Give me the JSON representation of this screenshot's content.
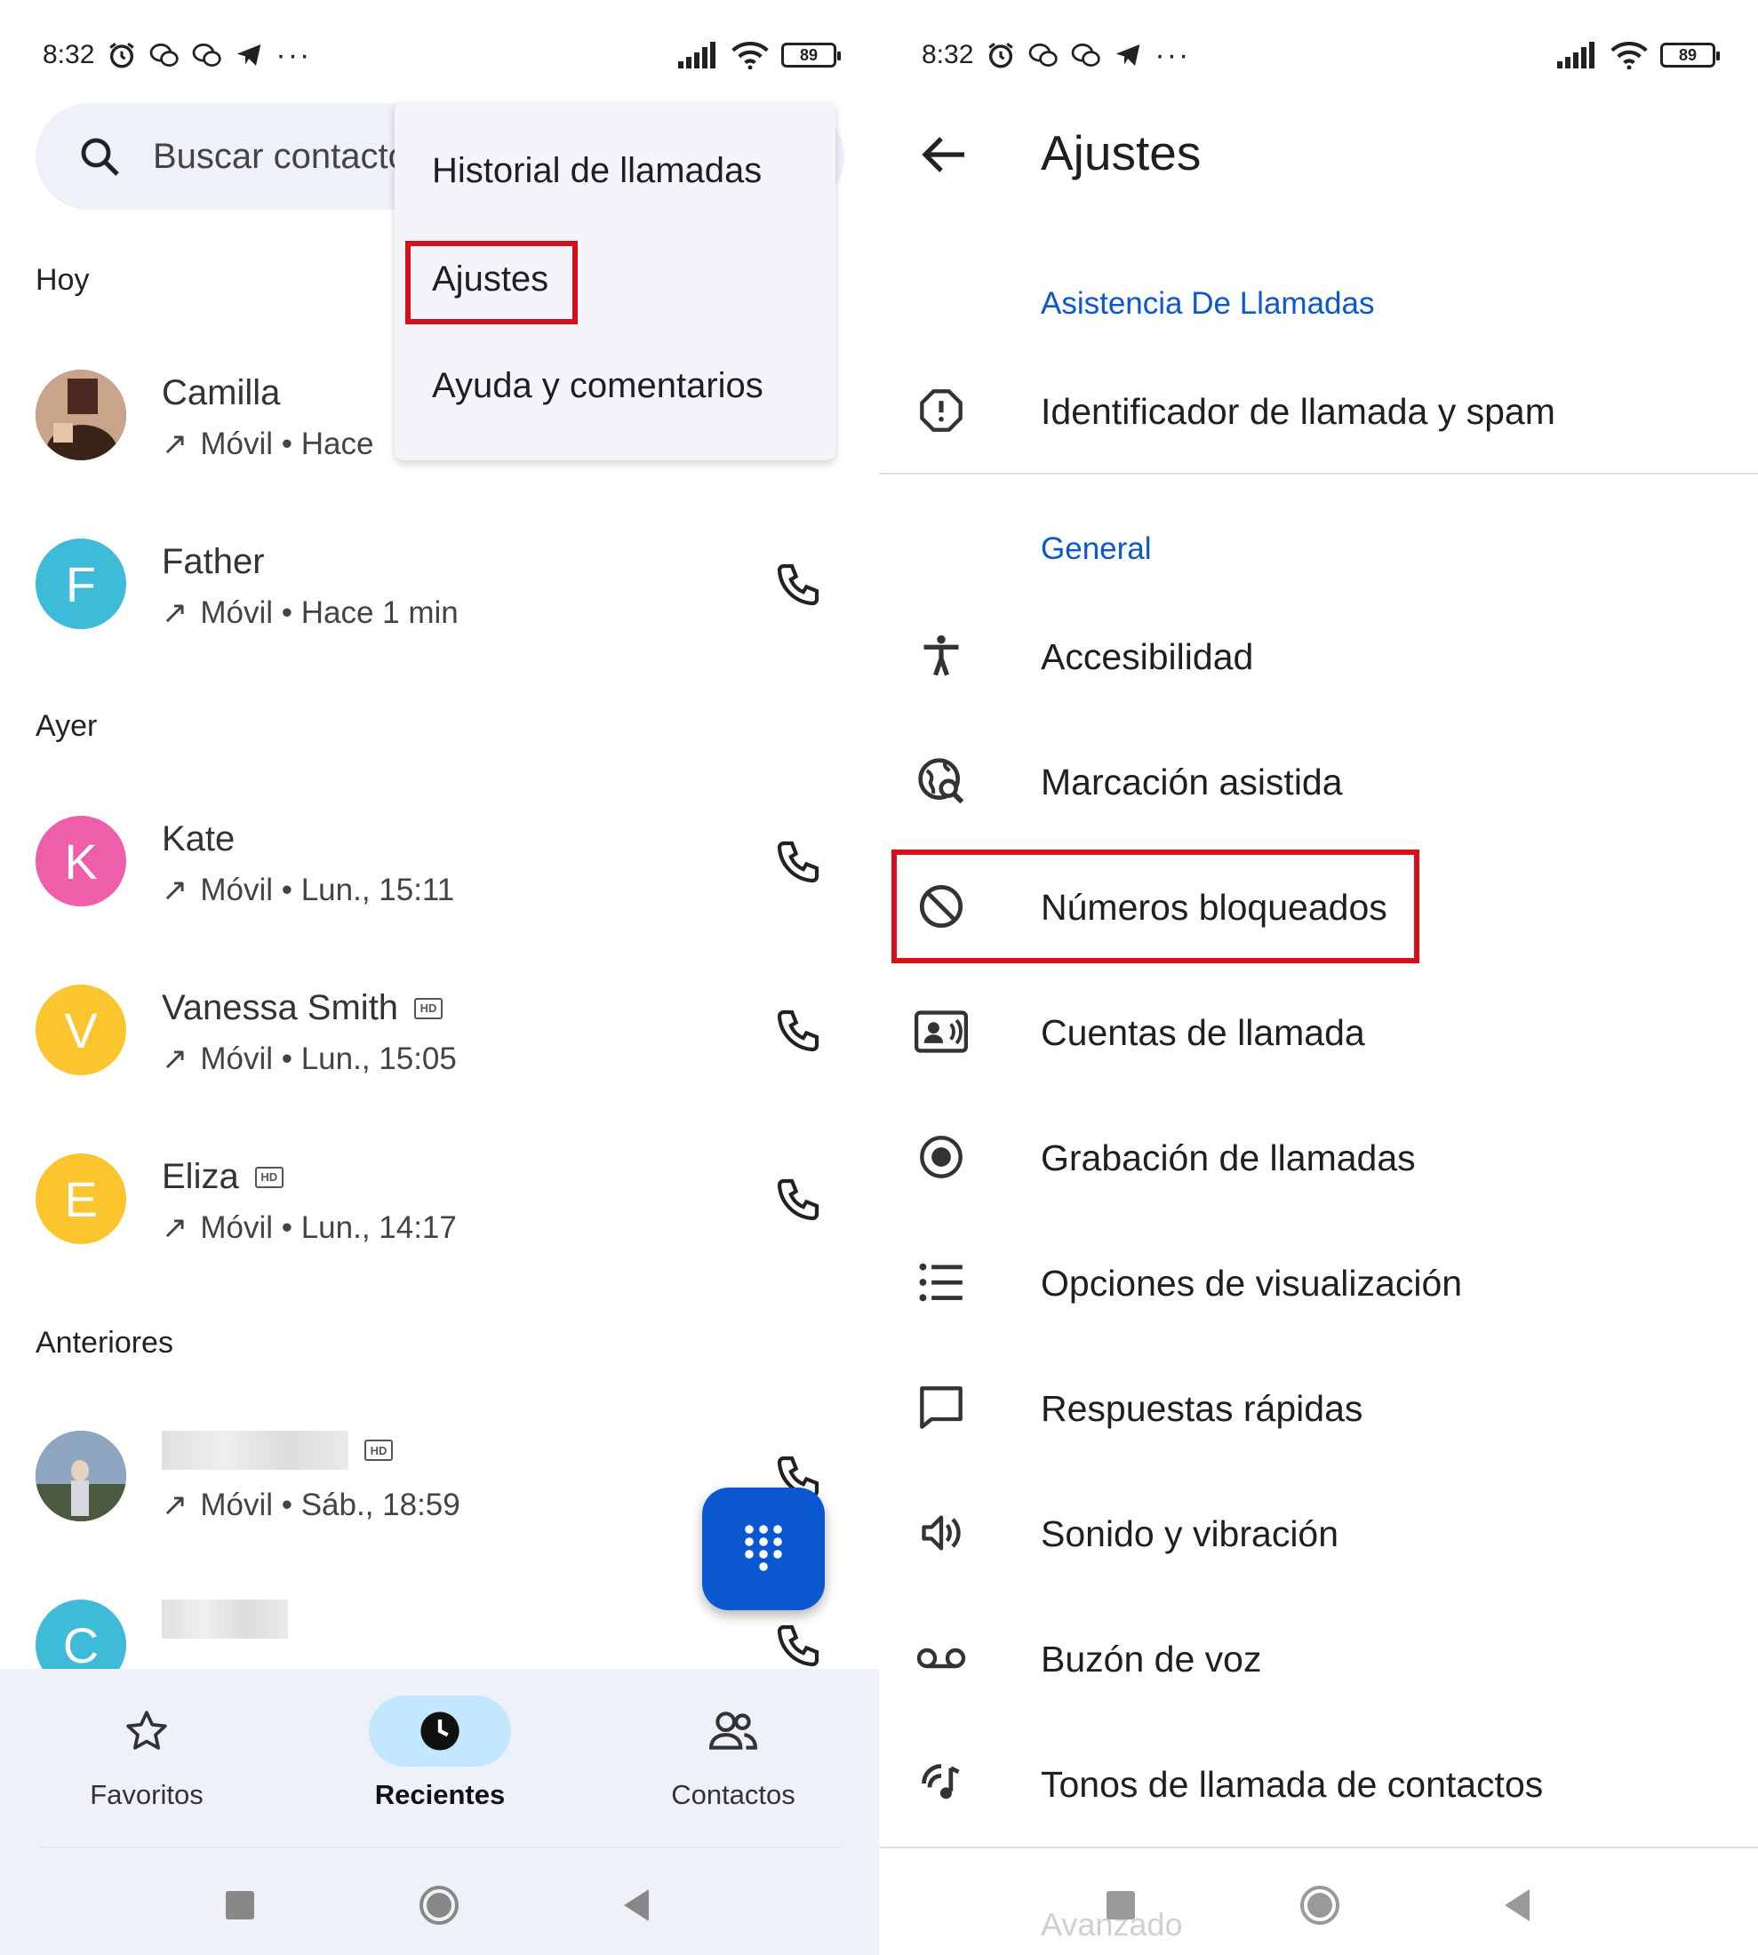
{
  "left": {
    "status": {
      "time": "8:32",
      "battery": "89"
    },
    "search": {
      "placeholder": "Buscar contactos"
    },
    "menu": {
      "items": [
        "Historial de llamadas",
        "Ajustes",
        "Ayuda y comentarios"
      ]
    },
    "sections": {
      "today": "Hoy",
      "yesterday": "Ayer",
      "older": "Anteriores"
    },
    "calls": [
      {
        "name": "Camilla",
        "detail": "Móvil • Hace",
        "letter": "",
        "color": "#7a5a48"
      },
      {
        "name": "Father",
        "detail": "Móvil • Hace 1 min",
        "letter": "F",
        "color": "#3dbbd8"
      },
      {
        "name": "Kate",
        "detail": "Móvil • Lun., 15:11",
        "letter": "K",
        "color": "#ef5fa9"
      },
      {
        "name": "Vanessa Smith",
        "detail": "Móvil • Lun., 15:05",
        "letter": "V",
        "color": "#fbc530"
      },
      {
        "name": "Eliza",
        "detail": "Móvil • Lun., 14:17",
        "letter": "E",
        "color": "#fbc530"
      },
      {
        "name": "",
        "detail": "Móvil • Sáb., 18:59",
        "letter": "",
        "color": "#3d5c7a"
      },
      {
        "name": "",
        "detail": "",
        "letter": "C",
        "color": "#3dbbd8"
      }
    ],
    "hd_label": "HD",
    "nav": {
      "favorites": "Favoritos",
      "recents": "Recientes",
      "contacts": "Contactos"
    }
  },
  "right": {
    "status": {
      "time": "8:32",
      "battery": "89"
    },
    "title": "Ajustes",
    "categories": {
      "assist": "Asistencia De Llamadas",
      "general": "General"
    },
    "items": [
      {
        "label": "Identificador de llamada y spam",
        "icon": "alert-octagon-icon"
      },
      {
        "label": "Accesibilidad",
        "icon": "accessibility-icon"
      },
      {
        "label": "Marcación asistida",
        "icon": "globe-search-icon"
      },
      {
        "label": "Números bloqueados",
        "icon": "block-icon"
      },
      {
        "label": "Cuentas de llamada",
        "icon": "account-card-icon"
      },
      {
        "label": "Grabación de llamadas",
        "icon": "record-icon"
      },
      {
        "label": "Opciones de visualización",
        "icon": "list-icon"
      },
      {
        "label": "Respuestas rápidas",
        "icon": "message-icon"
      },
      {
        "label": "Sonido y vibración",
        "icon": "volume-icon"
      },
      {
        "label": "Buzón de voz",
        "icon": "voicemail-icon"
      },
      {
        "label": "Tonos de llamada de contactos",
        "icon": "ringtone-icon"
      }
    ],
    "advanced": "Avanzado"
  },
  "colors": {
    "accent": "#0b57d0",
    "highlight": "#d3101c",
    "nav_bg": "#eef2f8",
    "pill": "#c2e7ff"
  }
}
